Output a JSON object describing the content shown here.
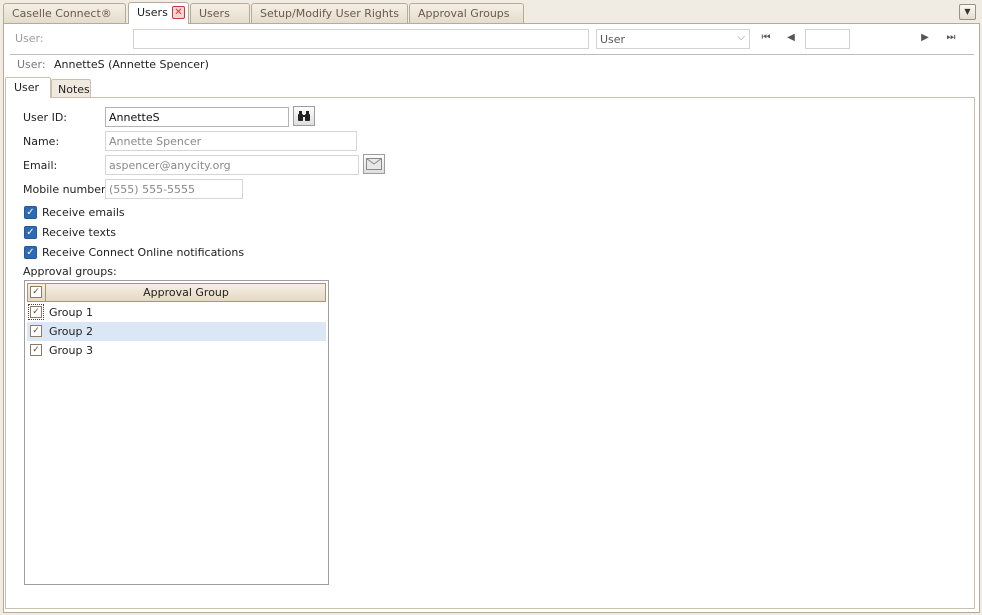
{
  "doc_tabs": [
    {
      "label": "Caselle Connect®"
    },
    {
      "label": "Users"
    },
    {
      "label": "Users"
    },
    {
      "label": "Setup/Modify User Rights"
    },
    {
      "label": "Approval Groups"
    }
  ],
  "icons": {
    "close": "close-icon",
    "menu": "chevron-down-icon",
    "lookup": "binoculars-icon",
    "email": "envelope-icon"
  },
  "lookup": {
    "label": "User:",
    "value": "",
    "type_selected": "User",
    "record": ""
  },
  "user_caption": {
    "label": "User:",
    "value": "AnnetteS (Annette Spencer)"
  },
  "inner_tabs": [
    {
      "label": "User"
    },
    {
      "label": "Notes"
    }
  ],
  "form": {
    "user_id_label": "User ID:",
    "user_id": "AnnetteS",
    "name_label": "Name:",
    "name": "Annette Spencer",
    "email_label": "Email:",
    "email": "aspencer@anycity.org",
    "mobile_label": "Mobile number:",
    "mobile": "(555) 555-5555"
  },
  "options": [
    {
      "label": "Receive emails",
      "checked": true
    },
    {
      "label": "Receive texts",
      "checked": true
    },
    {
      "label": "Receive Connect Online notifications",
      "checked": true
    }
  ],
  "approval": {
    "label": "Approval groups:",
    "column_header": "Approval Group",
    "rows": [
      {
        "label": "Group 1",
        "checked": true
      },
      {
        "label": "Group 2",
        "checked": true
      },
      {
        "label": "Group 3",
        "checked": true
      }
    ]
  },
  "colors": {
    "accent": "#2d6ab4",
    "selected_row": "#dce7f5",
    "tab_border": "#b7ab98"
  }
}
